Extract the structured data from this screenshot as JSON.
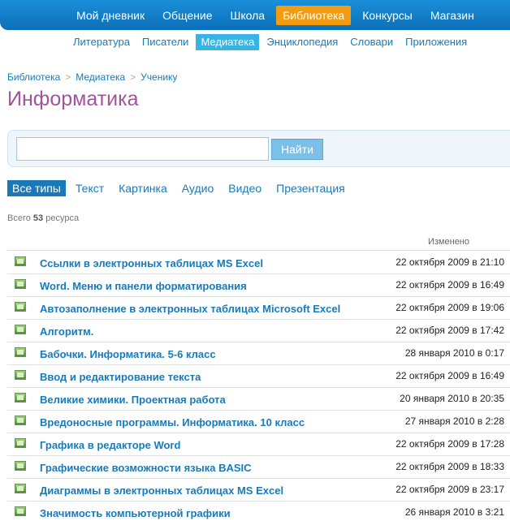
{
  "top_nav": [
    {
      "label": "Мой дневник",
      "active": false
    },
    {
      "label": "Общение",
      "active": false
    },
    {
      "label": "Школа",
      "active": false
    },
    {
      "label": "Библиотека",
      "active": true
    },
    {
      "label": "Конкурсы",
      "active": false
    },
    {
      "label": "Магазин",
      "active": false
    }
  ],
  "sub_nav": [
    {
      "label": "Литература",
      "active": false
    },
    {
      "label": "Писатели",
      "active": false
    },
    {
      "label": "Медиатека",
      "active": true
    },
    {
      "label": "Энциклопедия",
      "active": false
    },
    {
      "label": "Словари",
      "active": false
    },
    {
      "label": "Приложения",
      "active": false
    }
  ],
  "breadcrumb": [
    "Библиотека",
    "Медиатека",
    "Ученику"
  ],
  "breadcrumb_separator": ">",
  "page_title": "Информатика",
  "search": {
    "value": "",
    "placeholder": "",
    "button_label": "Найти"
  },
  "type_tabs": [
    {
      "label": "Все типы",
      "active": true
    },
    {
      "label": "Текст",
      "active": false
    },
    {
      "label": "Картинка",
      "active": false
    },
    {
      "label": "Аудио",
      "active": false
    },
    {
      "label": "Видео",
      "active": false
    },
    {
      "label": "Презентация",
      "active": false
    }
  ],
  "count": {
    "prefix": "Всего",
    "value": "53",
    "suffix": "ресурса"
  },
  "table": {
    "modified_header": "Изменено",
    "row_icon": "presentation-icon",
    "rows": [
      {
        "title": "Ссылки в электронных таблицах MS Excel",
        "date": "22 октября 2009 в 21:10"
      },
      {
        "title": "Word. Меню и панели форматирования",
        "date": "22 октября 2009 в 16:49"
      },
      {
        "title": "Автозаполнение в электронных таблицах Microsoft Excel",
        "date": "22 октября 2009 в 19:06"
      },
      {
        "title": "Алгоритм.",
        "date": "22 октября 2009 в 17:42"
      },
      {
        "title": "Бабочки. Информатика. 5-6 класс",
        "date": "28 января 2010 в 0:17"
      },
      {
        "title": "Ввод и редактирование текста",
        "date": "22 октября 2009 в 16:49"
      },
      {
        "title": "Великие химики. Проектная работа",
        "date": "20 января 2010 в 20:35"
      },
      {
        "title": "Вредоносные программы. Информатика. 10 класс",
        "date": "27 января 2010 в 2:28"
      },
      {
        "title": "Графика в редакторе Word",
        "date": "22 октября 2009 в 17:28"
      },
      {
        "title": "Графические возможности языка BASIC",
        "date": "22 октября 2009 в 18:33"
      },
      {
        "title": "Диаграммы в электронных таблицах MS Excel",
        "date": "22 октября 2009 в 23:17"
      },
      {
        "title": "Значимость компьютерной графики",
        "date": "26 января 2010 в 3:21"
      }
    ]
  },
  "colors": {
    "accent": "#1a7ab8",
    "active_tab": "#f39c12",
    "title": "#a0559a"
  }
}
